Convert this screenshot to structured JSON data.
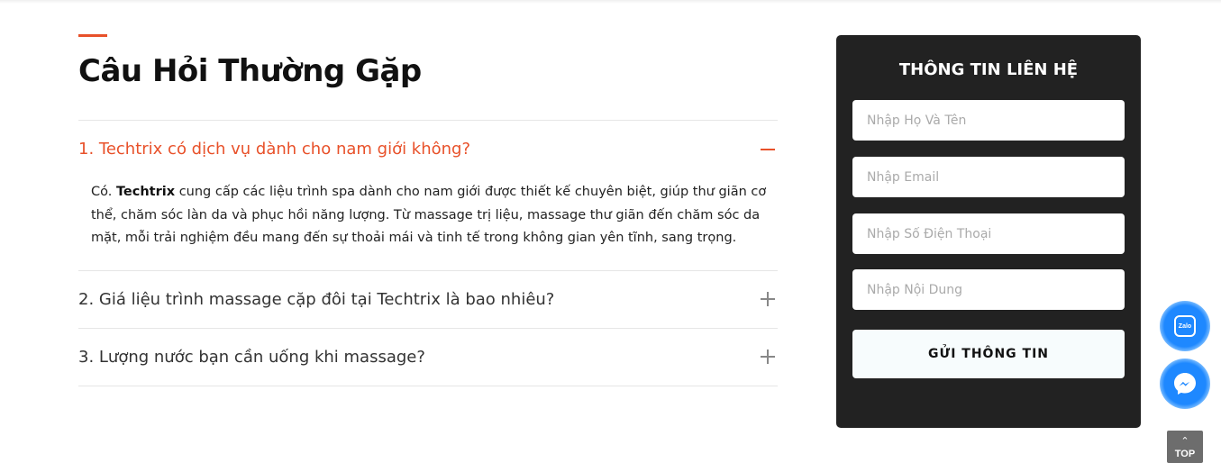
{
  "faq": {
    "title": "Câu Hỏi Thường Gặp",
    "items": [
      {
        "question": "1. Techtrix có dịch vụ dành cho nam giới không?",
        "expanded": true,
        "answer_prefix": "Có. ",
        "answer_brand": "Techtrix",
        "answer_rest": " cung cấp các liệu trình spa dành cho nam giới được thiết kế chuyên biệt, giúp thư giãn cơ thể, chăm sóc làn da và phục hồi năng lượng. Từ massage trị liệu, massage thư giãn đến chăm sóc da mặt, mỗi trải nghiệm đều mang đến sự thoải mái và tinh tế trong không gian yên tĩnh, sang trọng."
      },
      {
        "question": "2. Giá liệu trình massage cặp đôi tại Techtrix là bao nhiêu?",
        "expanded": false
      },
      {
        "question": "3. Lượng nước bạn cần uống khi massage?",
        "expanded": false
      }
    ]
  },
  "contact": {
    "title": "THÔNG TIN LIÊN HỆ",
    "name_placeholder": "Nhập Họ Và Tên",
    "email_placeholder": "Nhập Email",
    "phone_placeholder": "Nhập Số Điện Thoại",
    "message_placeholder": "Nhập Nội Dung",
    "submit_label": "GỬI THÔNG TIN"
  },
  "floating": {
    "zalo_label": "Zalo",
    "top_label": "TOP"
  },
  "colors": {
    "accent": "#e8512a",
    "panel_bg": "#222222",
    "float_blue": "#1e88ff"
  }
}
